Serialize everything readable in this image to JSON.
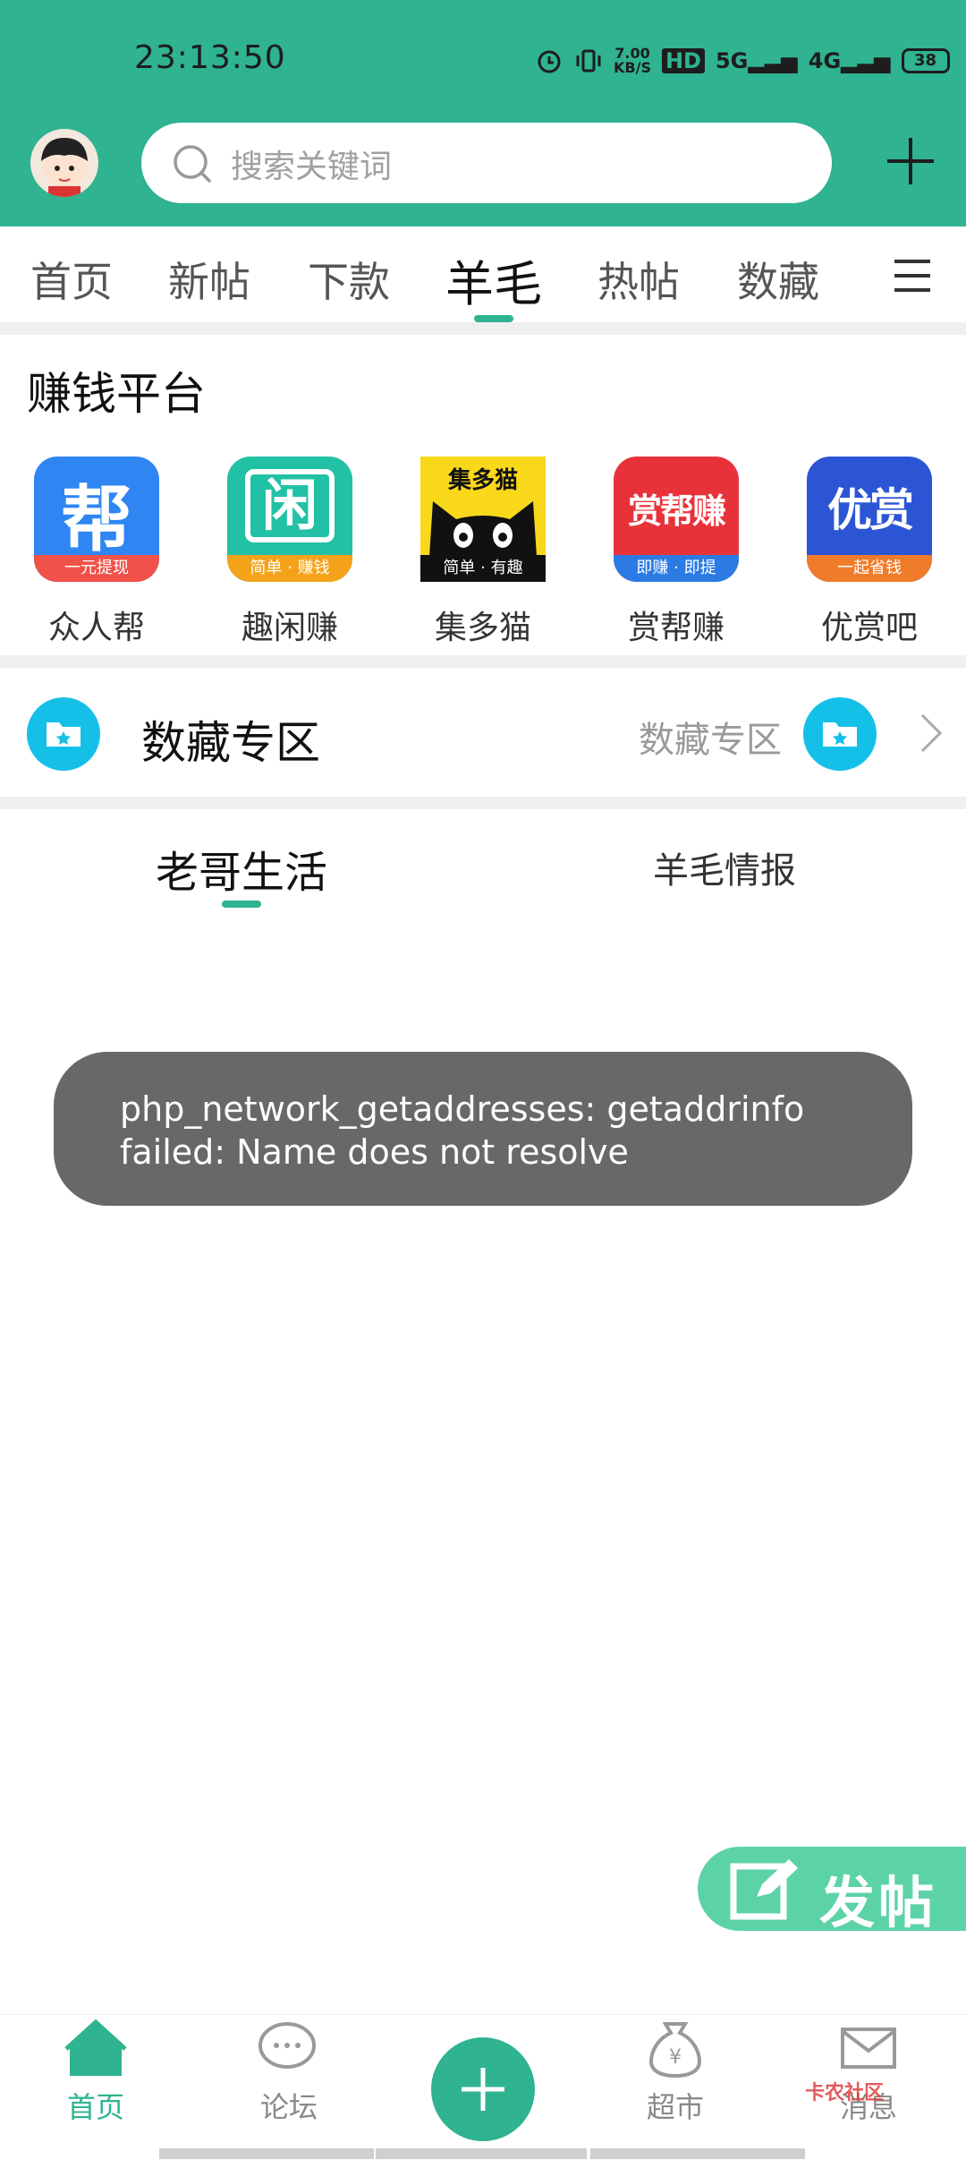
{
  "status_bar": {
    "time": "23:13:50",
    "net_speed_value": "7.00",
    "net_speed_unit": "KB/S",
    "hd": "HD",
    "sig5g": "5G",
    "sig4g": "4G",
    "battery": "38"
  },
  "header": {
    "search_placeholder": "搜索关键词"
  },
  "tabs": [
    {
      "label": "首页"
    },
    {
      "label": "新帖"
    },
    {
      "label": "下款"
    },
    {
      "label": "羊毛",
      "active": true
    },
    {
      "label": "热帖"
    },
    {
      "label": "数藏"
    }
  ],
  "earn": {
    "title": "赚钱平台",
    "apps": [
      {
        "label": "众人帮",
        "icon_text": "帮",
        "strip": "一元提现"
      },
      {
        "label": "趣闲赚",
        "icon_text": "闲",
        "strip": "简单 · 赚钱"
      },
      {
        "label": "集多猫",
        "icon_text": "集多猫",
        "strip": "简单 · 有趣"
      },
      {
        "label": "赏帮赚",
        "icon_text": "赏帮赚",
        "strip": "即赚 · 即提"
      },
      {
        "label": "优赏吧",
        "icon_text": "优赏",
        "strip": "一起省钱"
      }
    ]
  },
  "digital_zone": {
    "title": "数藏专区",
    "right_label": "数藏专区"
  },
  "sub_tabs": {
    "left": "老哥生活",
    "right": "羊毛情报"
  },
  "toast": {
    "message": "php_network_getaddresses: getaddrinfo failed: Name does not resolve"
  },
  "fab": {
    "label": "发帖"
  },
  "bottom_nav": {
    "home": "首页",
    "forum": "论坛",
    "market": "超市",
    "messages": "消息"
  },
  "watermark": "卡农社区",
  "colors": {
    "brand": "#2fb390",
    "toast_bg": "#686868",
    "zone_icon": "#14c0e8"
  }
}
